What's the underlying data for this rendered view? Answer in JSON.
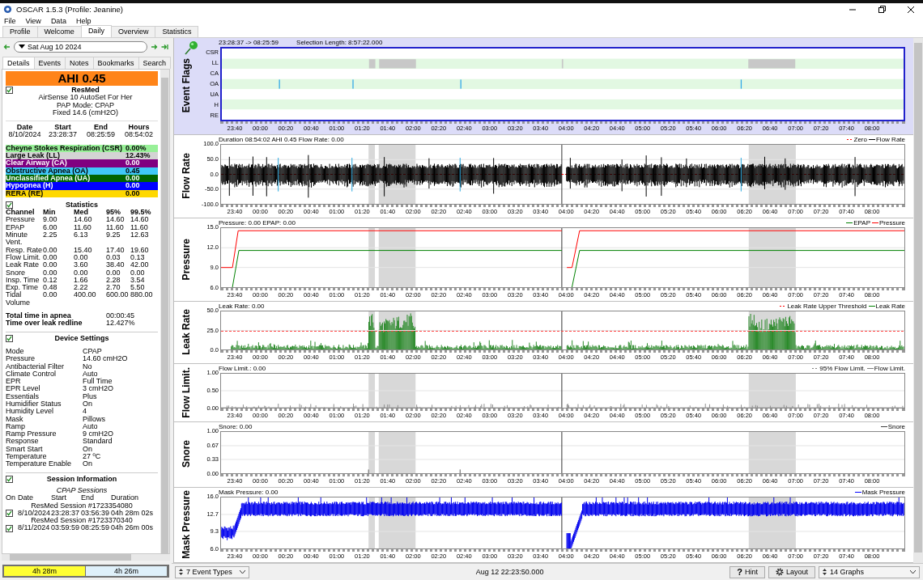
{
  "window": {
    "title": "OSCAR 1.5.3 (Profile: Jeanine)"
  },
  "menu": [
    "File",
    "View",
    "Data",
    "Help"
  ],
  "main_tabs": [
    {
      "label": "Profile",
      "selected": false
    },
    {
      "label": "Welcome",
      "selected": false
    },
    {
      "label": "Daily",
      "selected": true
    },
    {
      "label": "Overview",
      "selected": false
    },
    {
      "label": "Statistics",
      "selected": false
    }
  ],
  "date_nav": {
    "date": "Sat Aug 10 2024"
  },
  "detail_tabs": [
    {
      "label": "Details",
      "selected": true
    },
    {
      "label": "Events",
      "selected": false
    },
    {
      "label": "Notes",
      "selected": false
    },
    {
      "label": "Bookmarks",
      "selected": false
    },
    {
      "label": "Search",
      "selected": false
    }
  ],
  "summary": {
    "ahi": "AHI 0.45",
    "checked": true,
    "brand": "ResMed",
    "model": "AirSense 10 AutoSet For Her",
    "mode": "PAP Mode: CPAP",
    "pressure": "Fixed 14.6 (cmH2O)",
    "columns": [
      "Date",
      "Start",
      "End",
      "Hours"
    ],
    "values": [
      "8/10/2024",
      "23:28:37",
      "08:25:59",
      "08:54:02"
    ]
  },
  "event_indices": [
    {
      "name": "Cheyne Stokes Respiration (CSR)",
      "value": "0.00%",
      "color": "#98f098"
    },
    {
      "name": "Large Leak (LL)",
      "value": "12.43%",
      "color": "#d4d4d4"
    },
    {
      "name": "Clear Airway (CA)",
      "value": "0.00",
      "color": "#800080"
    },
    {
      "name": "Obstructive Apnea (OA)",
      "value": "0.45",
      "color": "#40c8f8"
    },
    {
      "name": "Unclassified Apnea (UA)",
      "value": "0.00",
      "color": "#006400"
    },
    {
      "name": "Hypopnea (H)",
      "value": "0.00",
      "color": "#0000ff"
    },
    {
      "name": "RERA (RE)",
      "value": "0.00",
      "color": "#ffd800"
    }
  ],
  "statistics": {
    "checked": true,
    "title": "Statistics",
    "columns": [
      "Channel",
      "Min",
      "Med",
      "95%",
      "99.5%"
    ],
    "rows": [
      [
        "Pressure",
        "9.00",
        "14.60",
        "14.60",
        "14.60"
      ],
      [
        "EPAP",
        "6.00",
        "11.60",
        "11.60",
        "11.60"
      ],
      [
        "Minute Vent.",
        "2.25",
        "6.13",
        "9.25",
        "12.63"
      ],
      [
        "Resp. Rate",
        "0.00",
        "15.40",
        "17.40",
        "19.60"
      ],
      [
        "Flow Limit.",
        "0.00",
        "0.00",
        "0.03",
        "0.13"
      ],
      [
        "Leak Rate",
        "0.00",
        "3.60",
        "38.40",
        "42.00"
      ],
      [
        "Snore",
        "0.00",
        "0.00",
        "0.00",
        "0.00"
      ],
      [
        "Insp. Time",
        "0.12",
        "1.66",
        "2.28",
        "3.54"
      ],
      [
        "Exp. Time",
        "0.48",
        "2.22",
        "2.70",
        "5.50"
      ],
      [
        "Tidal Volume",
        "0.00",
        "400.00",
        "600.00",
        "880.00"
      ]
    ],
    "totals": [
      [
        "Total time in apnea",
        "00:00:45"
      ],
      [
        "Time over leak redline",
        "12.427%"
      ]
    ]
  },
  "device_settings": {
    "checked": true,
    "title": "Device Settings",
    "rows": [
      [
        "Mode",
        "CPAP"
      ],
      [
        "Pressure",
        "14.60 cmH2O"
      ],
      [
        "Antibacterial Filter",
        "No"
      ],
      [
        "Climate Control",
        "Auto"
      ],
      [
        "EPR",
        "Full Time"
      ],
      [
        "EPR Level",
        "3 cmH2O"
      ],
      [
        "Essentials",
        "Plus"
      ],
      [
        "Humidifier Status",
        "On"
      ],
      [
        "Humidity Level",
        "4"
      ],
      [
        "Mask",
        "Pillows"
      ],
      [
        "Ramp",
        "Auto"
      ],
      [
        "Ramp Pressure",
        "9 cmH2O"
      ],
      [
        "Response",
        "Standard"
      ],
      [
        "Smart Start",
        "On"
      ],
      [
        "Temperature",
        "27 ºC"
      ],
      [
        "Temperature Enable",
        "On"
      ]
    ]
  },
  "session_info": {
    "checked": true,
    "title": "Session Information",
    "subtitle": "CPAP Sessions",
    "columns": [
      "On",
      "Date",
      "Start",
      "End",
      "Duration"
    ],
    "sessions": [
      {
        "name": "ResMed Session #1723354080",
        "checked": true,
        "cells": [
          "8/10/2024",
          "23:28:37",
          "03:56:39",
          "04h 28m 02s"
        ]
      },
      {
        "name": "ResMed Session #1723370340",
        "checked": true,
        "cells": [
          "8/11/2024",
          "03:59:59",
          "08:25:59",
          "04h 26m 00s"
        ]
      }
    ]
  },
  "session_bar": [
    {
      "label": "4h 28m",
      "color": "#ffff33"
    },
    {
      "label": "4h 26m",
      "color": "#dff0fa"
    }
  ],
  "graphs": [
    {
      "kind": "flags",
      "title": "Event Flags",
      "readouts": [
        "23:28:37 -> 08:25:59",
        "Selection Length: 8:57:22.000"
      ],
      "y_labels": [
        "CSR",
        "LL",
        "CA",
        "OA",
        "UA",
        "H",
        "RE"
      ],
      "x_labels": [
        "23:40",
        "00:00",
        "00:20",
        "00:40",
        "01:00",
        "01:20",
        "01:40",
        "02:00",
        "02:20",
        "02:40",
        "03:00",
        "03:20",
        "03:40",
        "04:00",
        "04:20",
        "04:40",
        "05:00",
        "05:20",
        "05:40",
        "06:00",
        "06:20",
        "06:40",
        "07:00",
        "07:20",
        "07:40",
        "08:00"
      ]
    },
    {
      "kind": "flow",
      "title": "Flow Rate",
      "readouts": [
        "Duration 08:54:02 AHI 0.45 Flow Rate: 0.00"
      ],
      "legend": [
        {
          "label": "Zero",
          "color": "#ff0000",
          "dashed": true
        },
        {
          "label": "Flow Rate",
          "color": "#000000",
          "dashed": false
        }
      ],
      "y_labels": [
        "100.0",
        "50.0",
        "0.0",
        "-50.0",
        "-100.0"
      ],
      "x_labels": [
        "23:40",
        "00:00",
        "00:20",
        "00:40",
        "01:00",
        "01:20",
        "01:40",
        "02:00",
        "02:20",
        "02:40",
        "03:00",
        "03:20",
        "03:40",
        "04:00",
        "04:20",
        "04:40",
        "05:00",
        "05:20",
        "05:40",
        "06:00",
        "06:20",
        "06:40",
        "07:00",
        "07:20",
        "07:40",
        "08:00"
      ]
    },
    {
      "kind": "pressure",
      "title": "Pressure",
      "readouts": [
        "Pressure: 0.00 EPAP: 0.00"
      ],
      "legend": [
        {
          "label": "EPAP",
          "color": "#008000",
          "dashed": false
        },
        {
          "label": "Pressure",
          "color": "#ff0000",
          "dashed": false
        }
      ],
      "y_labels": [
        "15.0",
        "12.0",
        "9.0",
        "6.0"
      ],
      "x_labels": [
        "23:40",
        "00:00",
        "00:20",
        "00:40",
        "01:00",
        "01:20",
        "01:40",
        "02:00",
        "02:20",
        "02:40",
        "03:00",
        "03:20",
        "03:40",
        "04:00",
        "04:20",
        "04:40",
        "05:00",
        "05:20",
        "05:40",
        "06:00",
        "06:20",
        "06:40",
        "07:00",
        "07:20",
        "07:40",
        "08:00"
      ]
    },
    {
      "kind": "leak",
      "title": "Leak Rate",
      "readouts": [
        "Leak Rate: 0.00"
      ],
      "legend": [
        {
          "label": "Leak Rate Upper Threshold",
          "color": "#ff0000",
          "dashed": true
        },
        {
          "label": "Leak Rate",
          "color": "#008000",
          "dashed": false
        }
      ],
      "y_labels": [
        "50.0",
        "25.0",
        "0.0"
      ],
      "x_labels": [
        "23:40",
        "00:00",
        "00:20",
        "00:40",
        "01:00",
        "01:20",
        "01:40",
        "02:00",
        "02:20",
        "02:40",
        "03:00",
        "03:20",
        "03:40",
        "04:00",
        "04:20",
        "04:40",
        "05:00",
        "05:20",
        "05:40",
        "06:00",
        "06:20",
        "06:40",
        "07:00",
        "07:20",
        "07:40",
        "08:00"
      ]
    },
    {
      "kind": "flowlimit",
      "title": "Flow Limit.",
      "readouts": [
        "Flow Limit.: 0.00"
      ],
      "legend": [
        {
          "label": "95% Flow Limit.",
          "color": "#808080",
          "dashed": true
        },
        {
          "label": "Flow Limit.",
          "color": "#808080",
          "dashed": false
        }
      ],
      "y_labels": [
        "1.00",
        "0.50",
        "0.00"
      ],
      "x_labels": [
        "23:40",
        "00:00",
        "00:20",
        "00:40",
        "01:00",
        "01:20",
        "01:40",
        "02:00",
        "02:20",
        "02:40",
        "03:00",
        "03:20",
        "03:40",
        "04:00",
        "04:20",
        "04:40",
        "05:00",
        "05:20",
        "05:40",
        "06:00",
        "06:20",
        "06:40",
        "07:00",
        "07:20",
        "07:40",
        "08:00"
      ]
    },
    {
      "kind": "snore",
      "title": "Snore",
      "readouts": [
        "Snore: 0.00"
      ],
      "legend": [
        {
          "label": "Snore",
          "color": "#404040",
          "dashed": false
        }
      ],
      "y_labels": [
        "1.00",
        "0.67",
        "0.33",
        "0.00"
      ],
      "x_labels": [
        "23:40",
        "00:00",
        "00:20",
        "00:40",
        "01:00",
        "01:20",
        "01:40",
        "02:00",
        "02:20",
        "02:40",
        "03:00",
        "03:20",
        "03:40",
        "04:00",
        "04:20",
        "04:40",
        "05:00",
        "05:20",
        "05:40",
        "06:00",
        "06:20",
        "06:40",
        "07:00",
        "07:20",
        "07:40",
        "08:00"
      ]
    },
    {
      "kind": "mask",
      "title": "Mask Pressure",
      "readouts": [
        "Mask Pressure: 0.00"
      ],
      "legend": [
        {
          "label": "Mask Pressure",
          "color": "#0000ff",
          "dashed": false
        }
      ],
      "y_labels": [
        "16.0",
        "12.7",
        "9.3",
        "6.0"
      ],
      "x_labels": [
        "23:40",
        "00:00",
        "00:20",
        "00:40",
        "01:00",
        "01:20",
        "01:40",
        "02:00",
        "02:20",
        "02:40",
        "03:00",
        "03:20",
        "03:40",
        "04:00",
        "04:20",
        "04:40",
        "05:00",
        "05:20",
        "05:40",
        "06:00",
        "06:20",
        "06:40",
        "07:00",
        "07:20",
        "07:40",
        "08:00"
      ]
    }
  ],
  "status_bar": {
    "event_types": "7 Event Types",
    "time": "Aug 12 22:23:50.000",
    "hint_icon": "?",
    "hint": "Hint",
    "layout": "Layout",
    "graphs": "14 Graphs"
  }
}
